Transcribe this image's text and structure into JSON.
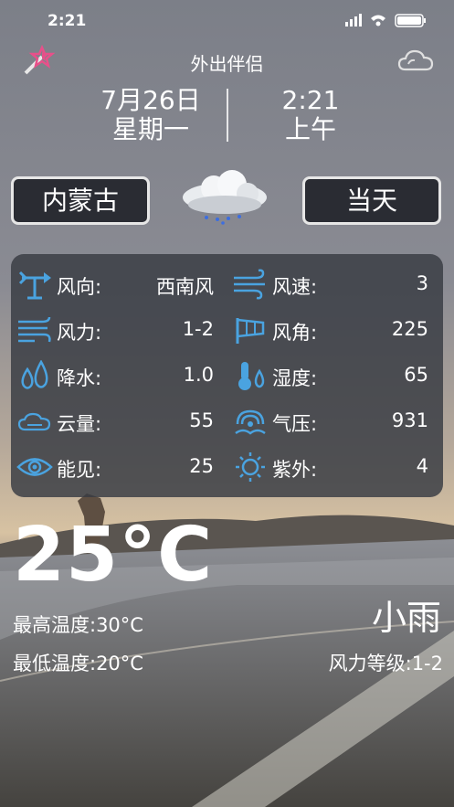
{
  "status_bar": {
    "time": "2:21"
  },
  "header": {
    "title": "外出伴侣"
  },
  "date": {
    "date": "7月26日",
    "weekday": "星期一",
    "time": "2:21",
    "ampm": "上午"
  },
  "buttons": {
    "region": "内蒙古",
    "day": "当天"
  },
  "details": [
    {
      "left": {
        "icon": "wind-vane-icon",
        "label": "风向:",
        "value": "西南风"
      },
      "right": {
        "icon": "wind-speed-icon",
        "label": "风速:",
        "value": "3"
      }
    },
    {
      "left": {
        "icon": "wind-force-icon",
        "label": "风力:",
        "value": "1-2"
      },
      "right": {
        "icon": "wind-sock-icon",
        "label": "风角:",
        "value": "225"
      }
    },
    {
      "left": {
        "icon": "rain-drops-icon",
        "label": "降水:",
        "value": "1.0"
      },
      "right": {
        "icon": "thermometer-humidity-icon",
        "label": "湿度:",
        "value": "65"
      }
    },
    {
      "left": {
        "icon": "cloud-icon",
        "label": "云量:",
        "value": "55"
      },
      "right": {
        "icon": "pressure-icon",
        "label": "气压:",
        "value": "931"
      }
    },
    {
      "left": {
        "icon": "eye-icon",
        "label": "能见:",
        "value": "25"
      },
      "right": {
        "icon": "sun-icon",
        "label": "紫外:",
        "value": "4"
      }
    }
  ],
  "current": {
    "temperature": "25°C",
    "high": "最高温度:30°C",
    "low": "最低温度:20°C",
    "condition": "小雨",
    "wind_level": "风力等级:1-2"
  },
  "colors": {
    "icon_blue": "#4aa3e0",
    "panel": "#373a42"
  }
}
